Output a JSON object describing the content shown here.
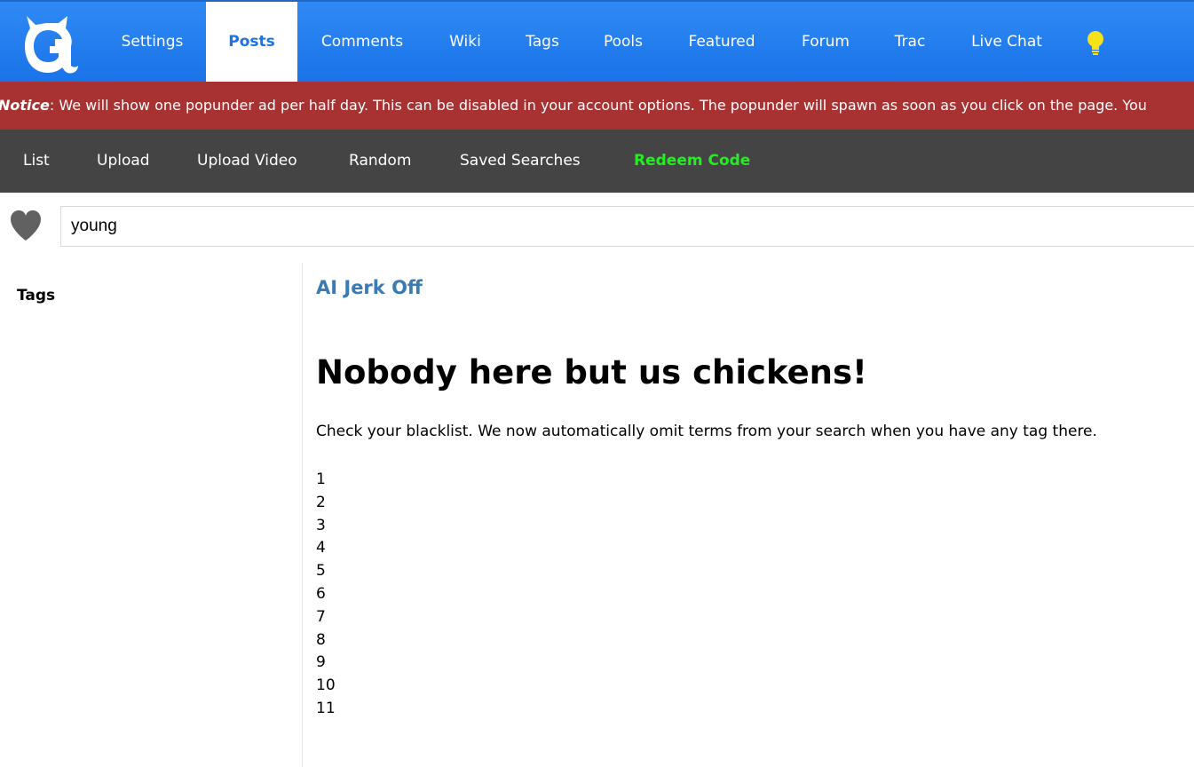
{
  "header": {
    "tabs": [
      {
        "label": "Settings"
      },
      {
        "label": "Posts"
      },
      {
        "label": "Comments"
      },
      {
        "label": "Wiki"
      },
      {
        "label": "Tags"
      },
      {
        "label": "Pools"
      },
      {
        "label": "Featured"
      },
      {
        "label": "Forum"
      },
      {
        "label": "Trac"
      },
      {
        "label": "Live Chat"
      }
    ],
    "active_tab": "Posts",
    "logo_icon": "site-logo-g",
    "theme_icon": "lightbulb-icon",
    "colors": {
      "nav_bg": "#1a73e8",
      "active_tab_text": "#1a73e8",
      "bulb": "#f5e21a"
    }
  },
  "notice": {
    "label": "Notice",
    "text": ": We will show one popunder ad per half day. This can be disabled in your account options. The popunder will spawn as soon as you click on the page. You",
    "color": "#a83232"
  },
  "subnav": {
    "items": [
      {
        "label": "List"
      },
      {
        "label": "Upload"
      },
      {
        "label": "Upload Video"
      },
      {
        "label": "Random"
      },
      {
        "label": "Saved Searches"
      },
      {
        "label": "Redeem Code"
      }
    ],
    "highlight_color": "#22ee22"
  },
  "search": {
    "value": "young",
    "favorite_icon": "heart-icon"
  },
  "sidebar": {
    "title": "Tags"
  },
  "main": {
    "ad_link": "AI Jerk Off",
    "headline": "Nobody here but us chickens!",
    "message": "Check your blacklist. We now automatically omit terms from your search when you have any tag there.",
    "pages": [
      "1",
      "2",
      "3",
      "4",
      "5",
      "6",
      "7",
      "8",
      "9",
      "10",
      "11"
    ]
  }
}
